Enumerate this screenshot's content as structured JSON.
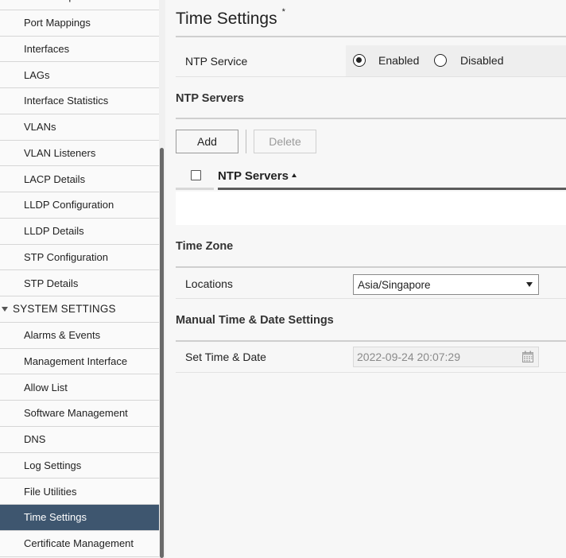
{
  "sidebar": {
    "items": [
      {
        "label": "Port Groups",
        "type": "item"
      },
      {
        "label": "Port Mappings",
        "type": "item"
      },
      {
        "label": "Interfaces",
        "type": "item"
      },
      {
        "label": "LAGs",
        "type": "item"
      },
      {
        "label": "Interface Statistics",
        "type": "item"
      },
      {
        "label": "VLANs",
        "type": "item"
      },
      {
        "label": "VLAN Listeners",
        "type": "item"
      },
      {
        "label": "LACP Details",
        "type": "item"
      },
      {
        "label": "LLDP Configuration",
        "type": "item"
      },
      {
        "label": "LLDP Details",
        "type": "item"
      },
      {
        "label": "STP Configuration",
        "type": "item"
      },
      {
        "label": "STP Details",
        "type": "item"
      },
      {
        "label": "SYSTEM SETTINGS",
        "type": "section"
      },
      {
        "label": "Alarms & Events",
        "type": "item"
      },
      {
        "label": "Management Interface",
        "type": "item"
      },
      {
        "label": "Allow List",
        "type": "item"
      },
      {
        "label": "Software Management",
        "type": "item"
      },
      {
        "label": "DNS",
        "type": "item"
      },
      {
        "label": "Log Settings",
        "type": "item"
      },
      {
        "label": "File Utilities",
        "type": "item"
      },
      {
        "label": "Time Settings",
        "type": "item",
        "active": true
      },
      {
        "label": "Certificate Management",
        "type": "item"
      }
    ]
  },
  "main": {
    "title": "Time Settings",
    "title_marker": "*",
    "ntp_service": {
      "label": "NTP Service",
      "options": [
        {
          "label": "Enabled",
          "selected": true
        },
        {
          "label": "Disabled",
          "selected": false
        }
      ]
    },
    "ntp_servers": {
      "section_title": "NTP Servers",
      "add_label": "Add",
      "delete_label": "Delete",
      "column_header": "NTP Servers"
    },
    "time_zone": {
      "section_title": "Time Zone",
      "locations_label": "Locations",
      "selected_location": "Asia/Singapore"
    },
    "manual_time": {
      "section_title": "Manual Time & Date Settings",
      "label": "Set Time & Date",
      "value": "2022-09-24 20:07:29"
    }
  },
  "colors": {
    "active_item_bg": "#3e566f",
    "scroll_thumb": "#6a6a6a"
  }
}
